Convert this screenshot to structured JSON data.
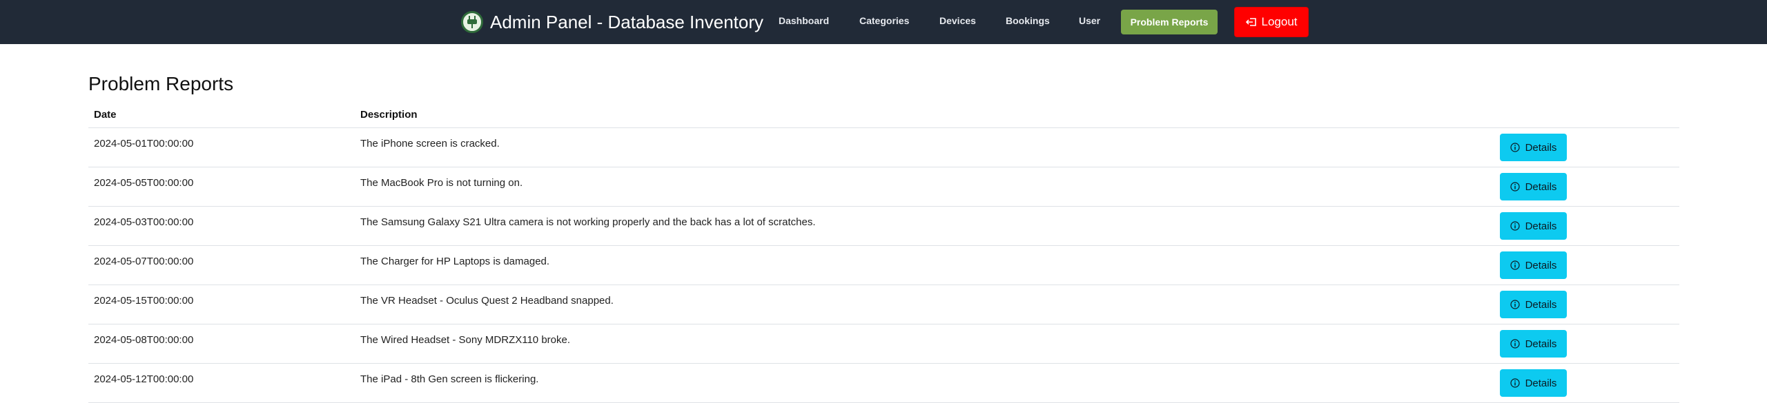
{
  "brand": {
    "title": "Admin Panel - Database Inventory"
  },
  "nav": {
    "items": [
      {
        "label": "Dashboard"
      },
      {
        "label": "Categories"
      },
      {
        "label": "Devices"
      },
      {
        "label": "Bookings"
      },
      {
        "label": "User"
      }
    ],
    "active_label": "Problem Reports",
    "logout_label": "Logout"
  },
  "page": {
    "title": "Problem Reports"
  },
  "table": {
    "headers": {
      "date": "Date",
      "description": "Description"
    },
    "details_label": "Details",
    "rows": [
      {
        "date": "2024-05-01T00:00:00",
        "description": "The iPhone screen is cracked."
      },
      {
        "date": "2024-05-05T00:00:00",
        "description": "The MacBook Pro is not turning on."
      },
      {
        "date": "2024-05-03T00:00:00",
        "description": "The Samsung Galaxy S21 Ultra camera is not working properly and the back has a lot of scratches."
      },
      {
        "date": "2024-05-07T00:00:00",
        "description": "The Charger for HP Laptops is damaged."
      },
      {
        "date": "2024-05-15T00:00:00",
        "description": "The VR Headset - Oculus Quest 2 Headband snapped."
      },
      {
        "date": "2024-05-08T00:00:00",
        "description": "The Wired Headset - Sony MDRZX110 broke."
      },
      {
        "date": "2024-05-12T00:00:00",
        "description": "The iPad - 8th Gen screen is flickering."
      }
    ]
  },
  "colors": {
    "navbar": "#212a37",
    "active_nav": "#79a548",
    "logout": "#ff0000",
    "details_button": "#0dcaf0"
  }
}
